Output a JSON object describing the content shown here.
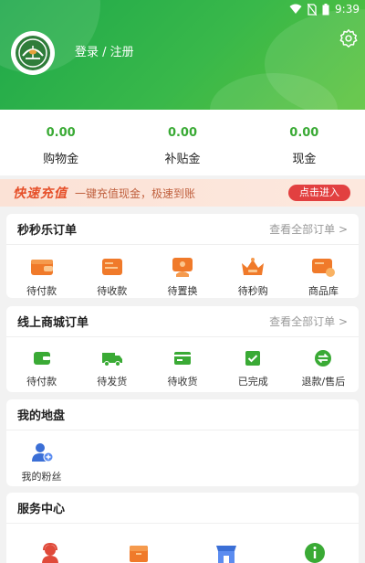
{
  "status_bar": {
    "time": "9:39"
  },
  "header": {
    "login_text": "登录 / 注册",
    "bg_start": "#1ea84a",
    "bg_end": "#5cc33b",
    "settings_icon": "gear-icon"
  },
  "wallet": [
    {
      "value": "0.00",
      "label": "购物金"
    },
    {
      "value": "0.00",
      "label": "补贴金"
    },
    {
      "value": "0.00",
      "label": "现金"
    }
  ],
  "banner": {
    "title": "快速充值",
    "subtitle": "一键充值现金，极速到账",
    "button": "点击进入",
    "button_color": "#e24040"
  },
  "seckill_orders": {
    "title": "秒秒乐订单",
    "more": "查看全部订单 >",
    "items": [
      {
        "label": "待付款",
        "icon": "wallet-orange-icon"
      },
      {
        "label": "待收款",
        "icon": "card-orange-icon"
      },
      {
        "label": "待置换",
        "icon": "exchange-hand-icon"
      },
      {
        "label": "待秒购",
        "icon": "crown-icon"
      },
      {
        "label": "商品库",
        "icon": "card-goods-icon"
      }
    ]
  },
  "mall_orders": {
    "title": "线上商城订单",
    "more": "查看全部订单 >",
    "items": [
      {
        "label": "待付款",
        "icon": "wallet-green-icon"
      },
      {
        "label": "待发货",
        "icon": "truck-icon"
      },
      {
        "label": "待收货",
        "icon": "card-green-icon"
      },
      {
        "label": "已完成",
        "icon": "check-box-icon"
      },
      {
        "label": "退款/售后",
        "icon": "refund-icon"
      }
    ]
  },
  "my_territory": {
    "title": "我的地盘",
    "items": [
      {
        "label": "我的粉丝",
        "icon": "fans-icon"
      }
    ]
  },
  "service_center": {
    "title": "服务中心"
  },
  "colors": {
    "accent_green": "#3aaa35",
    "accent_orange": "#f07a2a",
    "accent_blue": "#3b6fd6"
  }
}
